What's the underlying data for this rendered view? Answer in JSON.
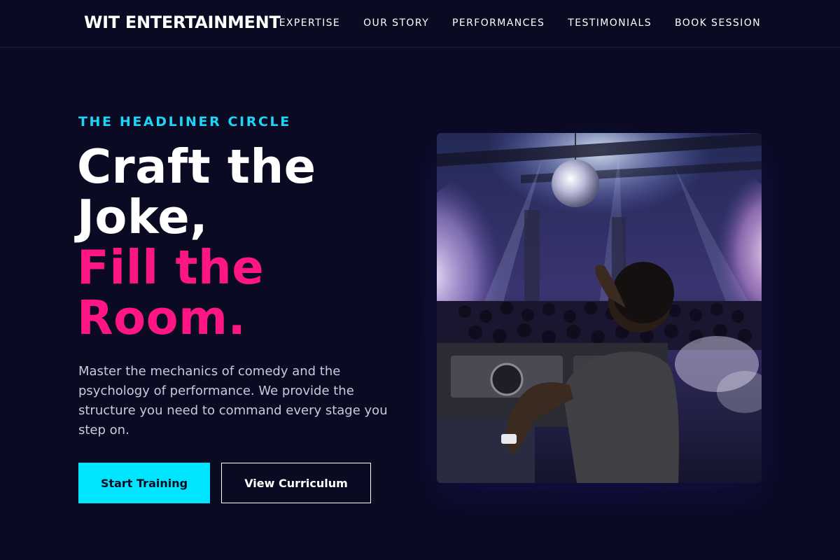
{
  "header": {
    "brand": "WIT ENTERTAINMENT",
    "nav": [
      {
        "label": "EXPERTISE"
      },
      {
        "label": "OUR STORY"
      },
      {
        "label": "PERFORMANCES"
      },
      {
        "label": "TESTIMONIALS"
      },
      {
        "label": "BOOK SESSION"
      }
    ]
  },
  "hero": {
    "eyebrow": "THE HEADLINER CIRCLE",
    "headline_white_1": "Craft the",
    "headline_white_2": "Joke,",
    "headline_pink_1": "Fill the",
    "headline_pink_2": "Room.",
    "description": "Master the mechanics of comedy and the psychology of performance. We provide the structure you need to command every stage you step on.",
    "primary_cta": "Start Training",
    "secondary_cta": "View Curriculum",
    "image_icon": "dj-crowd-photo"
  },
  "colors": {
    "background": "#0a0a22",
    "accent_cyan": "#00e5ff",
    "accent_pink": "#ff1684",
    "eyebrow": "#1cd6f7"
  }
}
